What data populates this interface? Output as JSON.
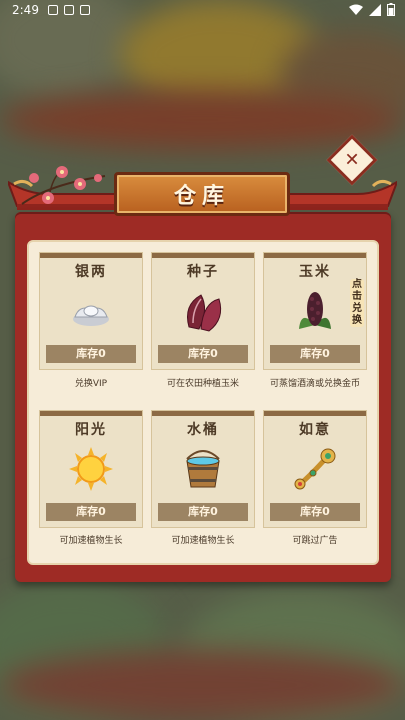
{
  "status_bar": {
    "time": "2:49"
  },
  "title": "仓库",
  "close_label": "✕",
  "items": [
    {
      "name": "银两",
      "stock": "库存0",
      "desc": "兑换VIP"
    },
    {
      "name": "种子",
      "stock": "库存0",
      "desc": "可在农田种植玉米"
    },
    {
      "name": "玉米",
      "stock": "库存0",
      "desc": "可蒸馏酒滴或兑换金币",
      "tag": "点击兑换"
    },
    {
      "name": "阳光",
      "stock": "库存0",
      "desc": "可加速植物生长"
    },
    {
      "name": "水桶",
      "stock": "库存0",
      "desc": "可加速植物生长"
    },
    {
      "name": "如意",
      "stock": "库存0",
      "desc": "可跳过广告"
    }
  ],
  "colors": {
    "panel": "#9e2b25",
    "plaque": "#c8742c",
    "card": "#ece1c7",
    "stock_bar": "#9c8463"
  }
}
